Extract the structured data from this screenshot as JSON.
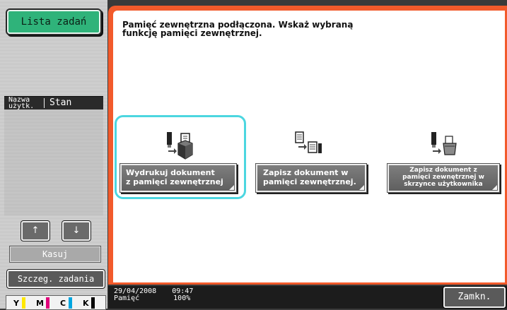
{
  "sidebar": {
    "job_list_label": "Lista zadań",
    "col_user": "Nazwa\nużytk.",
    "col_status": "Stan",
    "up_arrow": "↑",
    "down_arrow": "↓",
    "delete_label": "Kasuj",
    "job_details_label": "Szczeg. zadania",
    "toner": [
      {
        "letter": "Y",
        "color": "#ffe800"
      },
      {
        "letter": "M",
        "color": "#e0007a"
      },
      {
        "letter": "C",
        "color": "#00a6e0"
      },
      {
        "letter": "K",
        "color": "#000000"
      }
    ]
  },
  "main": {
    "message": "Pamięć zewnętrzna podłączona. Wskaż wybraną\nfunkcję pamięci zewnętrznej.",
    "functions": [
      {
        "label": "Wydrukuj dokument\nz pamięci zewnętrznej",
        "icon": "usb-to-printer-icon",
        "selected": true
      },
      {
        "label": "Zapisz dokument w\npamięci zewnętrznej.",
        "icon": "document-to-usb-icon",
        "selected": false
      },
      {
        "label": "Zapisz dokument z\npamięci zewnętrznej w\nskrzynce użytkownika",
        "icon": "usb-to-box-icon",
        "selected": false
      }
    ]
  },
  "status_bar": {
    "date": "29/04/2008",
    "time": "09:47",
    "memory_label": "Pamięć",
    "memory_value": "100%",
    "close_label": "Zamkn."
  },
  "colors": {
    "accent_orange": "#f25a2b",
    "job_list_green": "#2fb37a",
    "selection_cyan": "#4cd6e0"
  }
}
